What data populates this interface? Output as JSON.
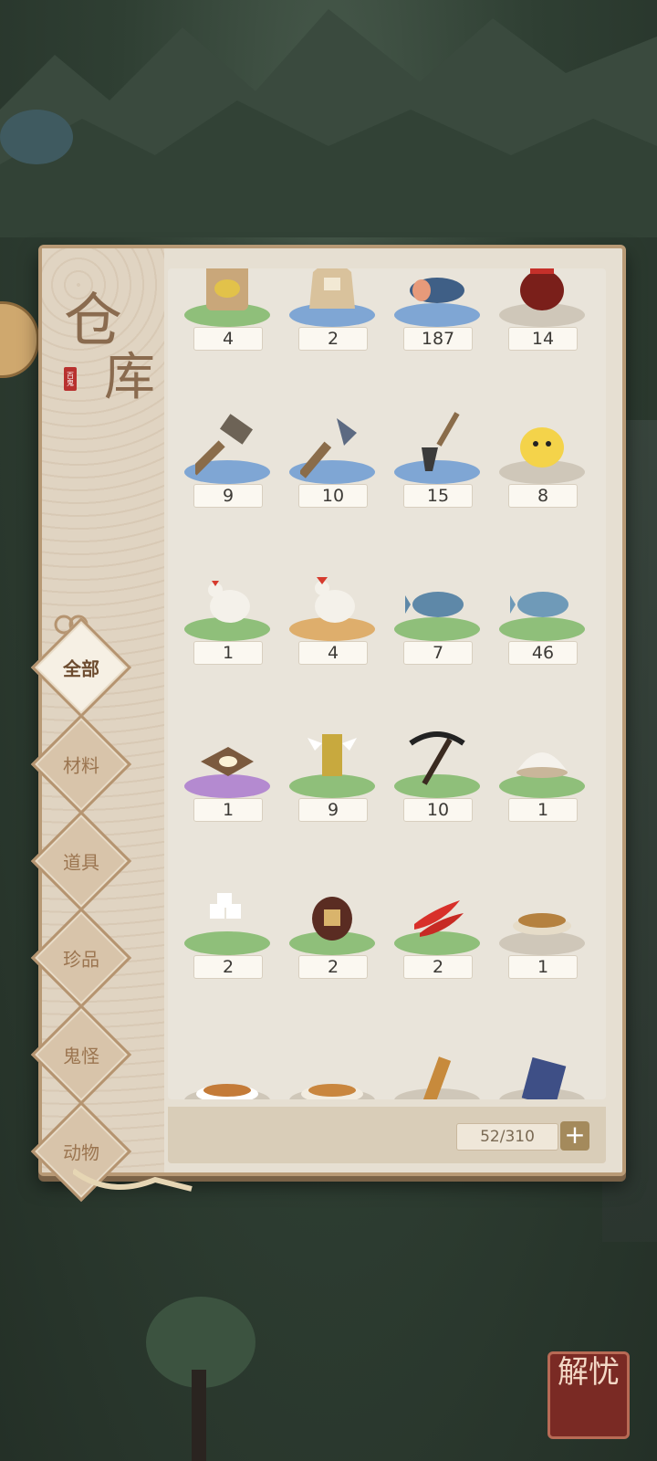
{
  "panel": {
    "title_char1": "仓",
    "title_char2": "库",
    "seal_text": "百鬼"
  },
  "categories": [
    {
      "label": "全部",
      "active": true
    },
    {
      "label": "材料",
      "active": false
    },
    {
      "label": "道具",
      "active": false
    },
    {
      "label": "珍品",
      "active": false
    },
    {
      "label": "鬼怪",
      "active": false
    },
    {
      "label": "动物",
      "active": false
    }
  ],
  "items": [
    {
      "name": "seed-bag-icon",
      "count": "4",
      "pad": "green"
    },
    {
      "name": "rice-sack-icon",
      "count": "2",
      "pad": "blue"
    },
    {
      "name": "salmon-fillet-icon",
      "count": "187",
      "pad": "blue"
    },
    {
      "name": "wine-jar-icon",
      "count": "14",
      "pad": "gray"
    },
    {
      "name": "hammer-icon",
      "count": "9",
      "pad": "blue"
    },
    {
      "name": "axe-icon",
      "count": "10",
      "pad": "blue"
    },
    {
      "name": "shovel-icon",
      "count": "15",
      "pad": "blue"
    },
    {
      "name": "chick-icon",
      "count": "8",
      "pad": "gray"
    },
    {
      "name": "hen-icon",
      "count": "1",
      "pad": "green"
    },
    {
      "name": "golden-rooster-icon",
      "count": "4",
      "pad": "orange"
    },
    {
      "name": "blue-fish-icon",
      "count": "7",
      "pad": "green"
    },
    {
      "name": "fish-icon",
      "count": "46",
      "pad": "green"
    },
    {
      "name": "egg-board-icon",
      "count": "1",
      "pad": "purple"
    },
    {
      "name": "winged-tablet-icon",
      "count": "9",
      "pad": "green"
    },
    {
      "name": "pickaxe-icon",
      "count": "10",
      "pad": "green"
    },
    {
      "name": "salt-pile-icon",
      "count": "1",
      "pad": "green"
    },
    {
      "name": "sugar-cubes-icon",
      "count": "2",
      "pad": "green"
    },
    {
      "name": "sealed-jar-icon",
      "count": "2",
      "pad": "green"
    },
    {
      "name": "chili-peppers-icon",
      "count": "2",
      "pad": "green"
    },
    {
      "name": "fish-dish-icon",
      "count": "1",
      "pad": "gray"
    },
    {
      "name": "grilled-fish-plate-icon",
      "count": "",
      "pad": "gray"
    },
    {
      "name": "fish-platter-icon",
      "count": "",
      "pad": "gray"
    },
    {
      "name": "scroll-icon",
      "count": "",
      "pad": "gray"
    },
    {
      "name": "book-icon",
      "count": "",
      "pad": "gray"
    }
  ],
  "footer": {
    "capacity": "52/310",
    "add_label": "+"
  },
  "corner_badge": {
    "text": "解忧"
  }
}
